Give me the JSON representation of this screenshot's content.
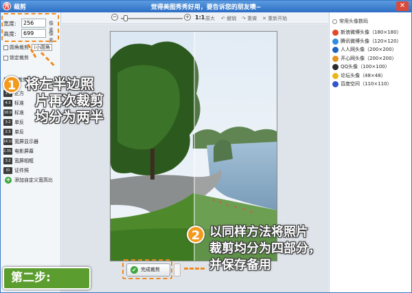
{
  "window": {
    "title": "裁剪",
    "slogan": "觉得美图秀秀好用，要告诉您的朋友噢~",
    "close_glyph": "✕",
    "logo_glyph": "秀"
  },
  "dimensions": {
    "width_label": "宽度:",
    "width_value": "256",
    "width_unit": "像素",
    "height_label": "高度:",
    "height_value": "699",
    "height_unit": "像素",
    "rounded_crop_label": "圆角裁剪",
    "rounded_crop_select": "(小圆角",
    "lock_ratio_label": "锁定裁剪"
  },
  "ratios": {
    "section_title": "按比例裁剪",
    "items": [
      {
        "icon_text": "",
        "label": ""
      },
      {
        "icon_text": "1:1",
        "label": "正方"
      },
      {
        "icon_text": "4:3",
        "label": "标准"
      },
      {
        "icon_text": "16:9",
        "label": "标准"
      },
      {
        "icon_text": "3:2",
        "label": "单反"
      },
      {
        "icon_text": "2:3",
        "label": "单反"
      },
      {
        "icon_text": "16:10",
        "label": "宽屏显示器"
      },
      {
        "icon_text": "2.35:1",
        "label": "电影屏幕"
      },
      {
        "icon_text": "3:2",
        "label": "宽屏相框"
      },
      {
        "icon_text": "ID",
        "label": "证件照"
      }
    ],
    "add_custom_label": "添加自定义宽高比"
  },
  "toolbar": {
    "zoom_ratio": "1:1",
    "fit_label": "原大",
    "undo_label": "撤销",
    "redo_label": "重做",
    "reset_label": "重新开始"
  },
  "presets": {
    "title": "常用头像数码",
    "items": [
      {
        "label": "新浪微博头像（180×180）",
        "color": "#e04a2a"
      },
      {
        "label": "腾讯微博头像（120×120）",
        "color": "#2f8de0"
      },
      {
        "label": "人人网头像（200×200）",
        "color": "#1f63c2"
      },
      {
        "label": "开心网头像（200×200）",
        "color": "#e8931b"
      },
      {
        "label": "QQ头像（100×100）",
        "color": "#2c2c2c"
      },
      {
        "label": "论坛头像（48×48）",
        "color": "#e9b718"
      },
      {
        "label": "百度空间（110×110）",
        "color": "#3355cc"
      }
    ]
  },
  "buttons": {
    "finish_label": "完成裁剪",
    "finish_icon": "✔"
  },
  "annotations": {
    "step1_number": "1",
    "step1_lines": [
      "将左半边照",
      "片再次裁剪",
      "均分为两半"
    ],
    "step2_number": "2",
    "step2_lines": [
      "以同样方法将照片",
      "裁剪均分为四部分，",
      "并保存备用"
    ],
    "step_badge": "第二步:",
    "accent_color": "#f08a1c",
    "badge_color": "#5b9d2e"
  }
}
